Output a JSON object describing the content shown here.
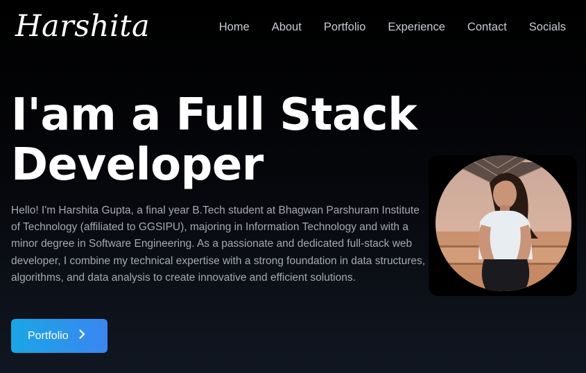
{
  "brand": {
    "logo_text": "Harshita"
  },
  "nav": {
    "items": [
      {
        "label": "Home",
        "name": "nav-home"
      },
      {
        "label": "About",
        "name": "nav-about"
      },
      {
        "label": "Portfolio",
        "name": "nav-portfolio"
      },
      {
        "label": "Experience",
        "name": "nav-experience"
      },
      {
        "label": "Contact",
        "name": "nav-contact"
      },
      {
        "label": "Socials",
        "name": "nav-socials"
      }
    ]
  },
  "hero": {
    "title_line1": "I'am a Full Stack",
    "title_line2": "Developer",
    "description": "Hello! I'm Harshita Gupta, a final year B.Tech student at Bhagwan Parshuram Institute of Technology (affiliated to GGSIPU), majoring in Information Technology and with a minor degree in Software Engineering. As a passionate and dedicated full-stack web developer, I combine my technical expertise with a strong foundation in data structures, algorithms, and data analysis to create innovative and efficient solutions.",
    "cta_label": "Portfolio",
    "cta_icon": "chevron-right-icon"
  },
  "colors": {
    "accent_start": "#1aa6e6",
    "accent_end": "#3b86f0",
    "background": "#000000",
    "nav_text": "#c9ccd3",
    "body_text": "#a6a9b1"
  }
}
